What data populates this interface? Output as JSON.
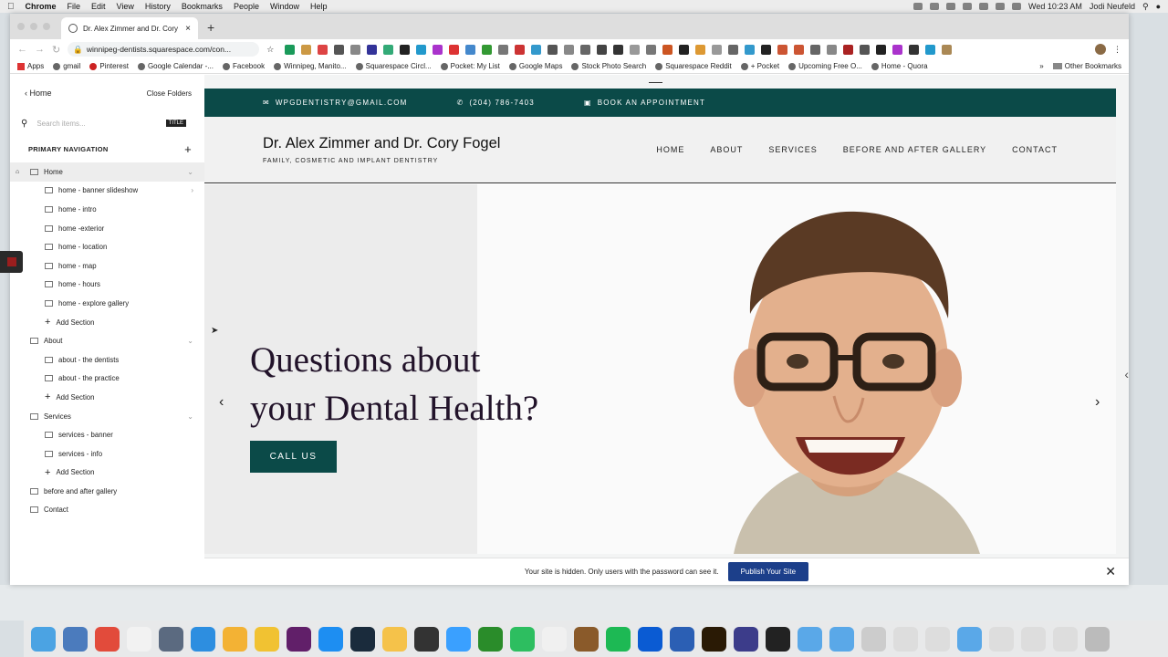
{
  "menubar": {
    "apple": "",
    "app": "Chrome",
    "items": [
      "File",
      "Edit",
      "View",
      "History",
      "Bookmarks",
      "People",
      "Window",
      "Help"
    ],
    "clock": "Wed 10:23 AM",
    "user": "Jodi Neufeld"
  },
  "browser": {
    "tab_title": "Dr. Alex Zimmer and Dr. Cory F",
    "url": "winnipeg-dentists.squarespace.com/con...",
    "new_tab": "+",
    "bookmarks": [
      "Apps",
      "gmail",
      "Pinterest",
      "Google Calendar -...",
      "Facebook",
      "Winnipeg, Manito...",
      "Squarespace Circl...",
      "Pocket: My List",
      "Google Maps",
      "Stock Photo Search",
      "Squarespace Reddit",
      "+ Pocket",
      "Upcoming Free O...",
      "Home - Quora"
    ],
    "bookmarks_more": "»",
    "other_bookmarks": "Other Bookmarks",
    "extension_colors": [
      "#1a9a5a",
      "#c94",
      "#d44",
      "#555",
      "#888",
      "#339",
      "#3a7",
      "#222",
      "#29c",
      "#a3c",
      "#d33",
      "#48c",
      "#393",
      "#777",
      "#c33",
      "#39c",
      "#555",
      "#888",
      "#666",
      "#444",
      "#333",
      "#999",
      "#777",
      "#c52",
      "#222",
      "#d93",
      "#999",
      "#666",
      "#39c",
      "#222",
      "#c53",
      "#c53",
      "#666",
      "#888",
      "#a22",
      "#555",
      "#222",
      "#a3c",
      "#333",
      "#29c",
      "#a85"
    ]
  },
  "sidebar": {
    "back_label": "Home",
    "close_folders": "Close Folders",
    "search_placeholder": "Search items...",
    "search_badge": "TITLE",
    "section_title": "PRIMARY NAVIGATION",
    "items": [
      {
        "label": "Home",
        "level": 0,
        "chevron": "⌄",
        "active": true
      },
      {
        "label": "home - banner slideshow",
        "level": 1,
        "chevron": "›"
      },
      {
        "label": "home - intro",
        "level": 1
      },
      {
        "label": "home -exterior",
        "level": 1
      },
      {
        "label": "home - location",
        "level": 1
      },
      {
        "label": "home - map",
        "level": 1
      },
      {
        "label": "home - hours",
        "level": 1
      },
      {
        "label": "home - explore gallery",
        "level": 1
      },
      {
        "label": "Add Section",
        "level": 1,
        "add": true
      },
      {
        "label": "About",
        "level": 0,
        "chevron": "⌄"
      },
      {
        "label": "about - the dentists",
        "level": 1
      },
      {
        "label": "about - the practice",
        "level": 1
      },
      {
        "label": "Add Section",
        "level": 1,
        "add": true
      },
      {
        "label": "Services",
        "level": 0,
        "chevron": "⌄"
      },
      {
        "label": "services - banner",
        "level": 1
      },
      {
        "label": "services - info",
        "level": 1
      },
      {
        "label": "Add Section",
        "level": 1,
        "add": true
      },
      {
        "label": "before and after gallery",
        "level": 0
      },
      {
        "label": "Contact",
        "level": 0
      }
    ]
  },
  "site": {
    "email": "WPGDENTISTRY@GMAIL.COM",
    "phone": "(204) 786-7403",
    "appointment": "BOOK AN APPOINTMENT",
    "brand_name": "Dr. Alex Zimmer and Dr. Cory Fogel",
    "brand_tagline": "FAMILY, COSMETIC AND IMPLANT DENTISTRY",
    "nav": [
      "HOME",
      "ABOUT",
      "SERVICES",
      "BEFORE AND AFTER GALLERY",
      "CONTACT"
    ],
    "hero_line1": "Questions about",
    "hero_line2": "your Dental Health?",
    "cta": "CALL US",
    "prev": "‹",
    "next": "›",
    "accent": "#0b4a48"
  },
  "publish": {
    "message": "Your site is hidden. Only users with the password can see it.",
    "button": "Publish Your Site",
    "close": "✕"
  },
  "dock": {
    "apps": [
      "finder",
      "preview",
      "chrome",
      "calendar",
      "launchpad",
      "safari",
      "photos",
      "norton",
      "slack",
      "app-store",
      "quicktime",
      "notes",
      "printer",
      "messages",
      "keynote-k",
      "evernote",
      "pages",
      "notebook",
      "spotify",
      "1password",
      "word",
      "bridge",
      "bbedit",
      "terminal",
      "folder",
      "folder",
      "help",
      "zip",
      "zip",
      "folder",
      "zip",
      "jpeg",
      "dots",
      "trash"
    ]
  }
}
